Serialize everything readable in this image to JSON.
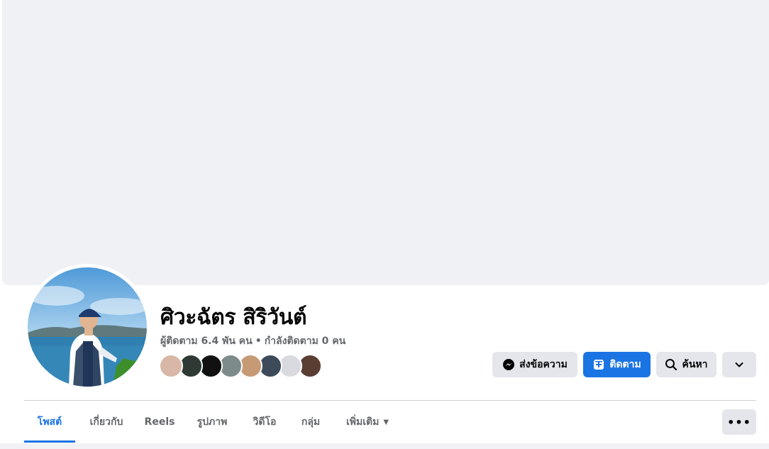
{
  "profile": {
    "name": "ศิวะฉัตร สิริวันต์",
    "followers_text": "ผู้ติดตาม 6.4 พัน คน",
    "separator": "•",
    "following_text": "กำลังติดตาม 0 คน"
  },
  "actions": {
    "message_label": "ส่งข้อความ",
    "follow_label": "ติดตาม",
    "search_label": "ค้นหา"
  },
  "tabs": [
    {
      "label": "โพสต์",
      "active": true
    },
    {
      "label": "เกี่ยวกับ"
    },
    {
      "label": "Reels"
    },
    {
      "label": "รูปภาพ"
    },
    {
      "label": "วิดีโอ"
    },
    {
      "label": "กลุ่ม"
    },
    {
      "label": "เพิ่มเติม"
    }
  ],
  "more_caret": "▼",
  "more_options": "•••",
  "colors": {
    "accent": "#1b74e4",
    "cover": "#f0f1f5",
    "button_grey": "#e4e6eb",
    "secondary_text": "#65676b"
  },
  "follower_avatars": [
    "#d9b7a6",
    "#2f3a35",
    "#111111",
    "#7d8c8a",
    "#c79a76",
    "#3c4a5a",
    "#d8dadf",
    "#5a3d33"
  ],
  "icons": {
    "message": "messenger-icon",
    "follow": "follow-plus-icon",
    "search": "search-icon",
    "expand": "chevron-down-icon",
    "more": "more-dots-icon"
  }
}
